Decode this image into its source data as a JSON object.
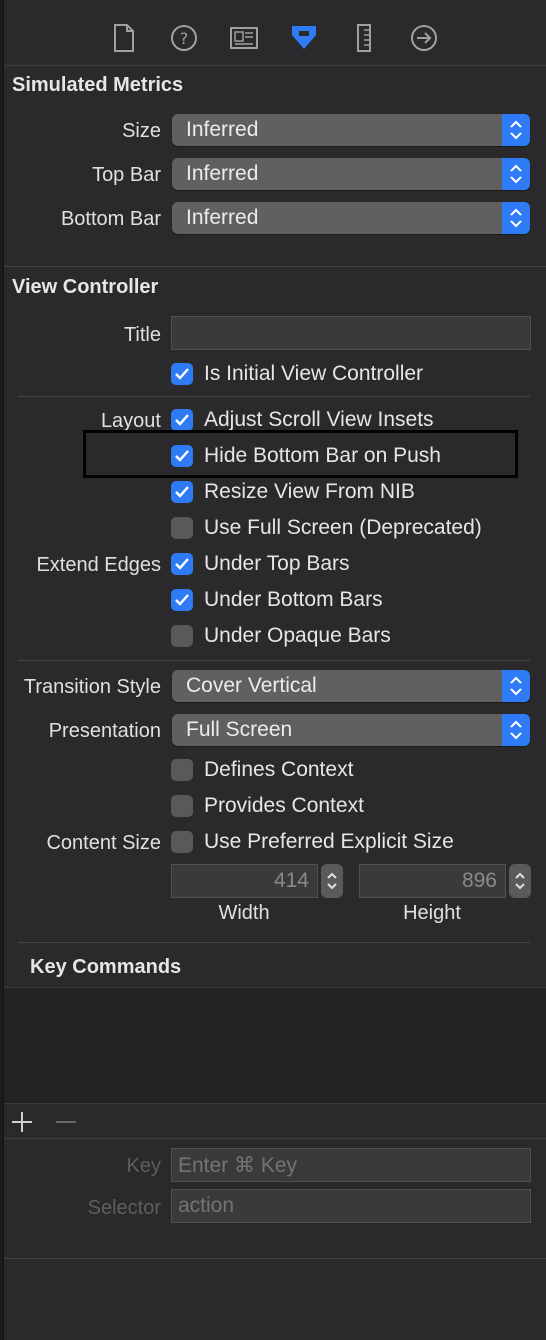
{
  "toolbar": {
    "icons": [
      "file-inspector-icon",
      "help-inspector-icon",
      "identity-inspector-icon",
      "attributes-inspector-icon",
      "size-inspector-icon",
      "connections-inspector-icon"
    ],
    "accent": "#2f7bf5"
  },
  "simulated_metrics": {
    "header": "Simulated Metrics",
    "size_label": "Size",
    "size_value": "Inferred",
    "top_bar_label": "Top Bar",
    "top_bar_value": "Inferred",
    "bottom_bar_label": "Bottom Bar",
    "bottom_bar_value": "Inferred"
  },
  "view_controller": {
    "header": "View Controller",
    "title_label": "Title",
    "title_value": "",
    "is_initial": "Is Initial View Controller",
    "layout_label": "Layout",
    "adjust_scroll": "Adjust Scroll View Insets",
    "hide_bottom_bar": "Hide Bottom Bar on Push",
    "resize_nib": "Resize View From NIB",
    "full_screen": "Use Full Screen (Deprecated)",
    "extend_edges_label": "Extend Edges",
    "under_top": "Under Top Bars",
    "under_bottom": "Under Bottom Bars",
    "under_opaque": "Under Opaque Bars",
    "transition_label": "Transition Style",
    "transition_value": "Cover Vertical",
    "presentation_label": "Presentation",
    "presentation_value": "Full Screen",
    "defines_context": "Defines Context",
    "provides_context": "Provides Context",
    "content_size_label": "Content Size",
    "preferred_size": "Use Preferred Explicit Size",
    "width_value": "414",
    "height_value": "896",
    "width_caption": "Width",
    "height_caption": "Height"
  },
  "checkbox_states": {
    "is_initial": true,
    "adjust_scroll": true,
    "hide_bottom_bar": true,
    "resize_nib": true,
    "full_screen": false,
    "under_top": true,
    "under_bottom": true,
    "under_opaque": false,
    "defines_context": false,
    "provides_context": false,
    "preferred_size": false
  },
  "key_commands": {
    "header": "Key Commands",
    "key_label": "Key",
    "key_placeholder": "Enter ⌘ Key",
    "selector_label": "Selector",
    "selector_placeholder": "action"
  }
}
